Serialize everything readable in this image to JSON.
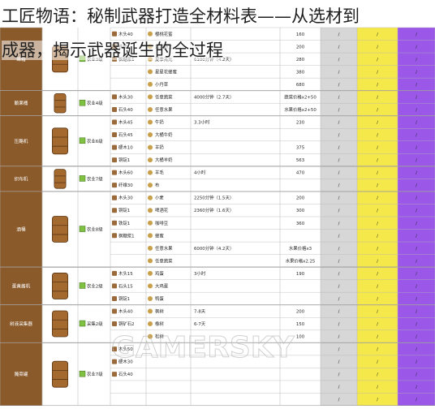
{
  "title": {
    "line1": "工匠物语：秘制武器打造全材料表——从选材到",
    "line2": "成器，揭示武器诞生的全过程"
  },
  "watermark": "GAMERSKY",
  "colors": {
    "brown": "#8a5a2b",
    "yellow": "#f5e84a",
    "purple": "#9a57e8",
    "grey": "#d7d7d7",
    "green": "#7fc241",
    "grid": "#b5b5b5"
  },
  "sections": [
    {
      "name": "蜂箱",
      "level": "农业3级",
      "rows": [
        {
          "mat": "木头40",
          "prod": "樱桃花蜜",
          "time": "",
          "sell": "160"
        },
        {
          "mat": "铁锭1",
          "prod": "蓝调爵士",
          "time": "",
          "sell": "200"
        },
        {
          "mat": "枫糖浆1",
          "prod": "夏季亮光",
          "time": "6100分钟（4.2天）",
          "sell": "280"
        },
        {
          "mat": "",
          "prod": "星星花蜂蜜",
          "time": "",
          "sell": "380"
        },
        {
          "mat": "",
          "prod": "小丹草",
          "time": "",
          "sell": "680"
        }
      ]
    },
    {
      "name": "酿果桶",
      "level": "农业4级",
      "rows": [
        {
          "mat": "木头30",
          "prod": "任意蔬菜",
          "time": "4000分钟（2.7天）",
          "sell": "蔬菜价格x2+50"
        },
        {
          "mat": "石头40",
          "prod": "任意水果",
          "time": "",
          "sell": "水果价格x2+50"
        }
      ]
    },
    {
      "name": "压酪机",
      "level": "农业6级",
      "rows": [
        {
          "mat": "木头45",
          "prod": "牛奶",
          "time": "3.3小时",
          "sell": "230"
        },
        {
          "mat": "石头45",
          "prod": "大桶牛奶",
          "time": "",
          "sell": ""
        },
        {
          "mat": "硬木10",
          "prod": "羊奶",
          "time": "",
          "sell": "375"
        },
        {
          "mat": "铜锭1",
          "prod": "大桶羊奶",
          "time": "",
          "sell": "563"
        }
      ]
    },
    {
      "name": "织布机",
      "level": "农业7级",
      "rows": [
        {
          "mat": "木头60",
          "prod": "羊毛",
          "time": "4小时",
          "sell": "470"
        },
        {
          "mat": "纤维30",
          "prod": "布",
          "time": "",
          "sell": ""
        }
      ]
    },
    {
      "name": "酒桶",
      "level": "农业8级",
      "rows": [
        {
          "mat": "木头30",
          "prod": "小麦",
          "time": "2250分钟（1.5天）",
          "sell": "200"
        },
        {
          "mat": "铜锭1",
          "prod": "啤酒花",
          "time": "2360分钟（1.6天）",
          "sell": "300"
        },
        {
          "mat": "铁锭1",
          "prod": "咖啡豆",
          "time": "",
          "sell": "360"
        },
        {
          "mat": "枫糖浆1",
          "prod": "蜂蜜",
          "time": "",
          "sell": ""
        },
        {
          "mat": "",
          "prod": "任意水果",
          "time": "6000分钟（4.2天）",
          "sell": "水果价格x3"
        },
        {
          "mat": "",
          "prod": "任意蔬菜",
          "time": "",
          "sell": "水果价格x2.25"
        }
      ]
    },
    {
      "name": "蛋黄酱机",
      "level": "农业2级",
      "rows": [
        {
          "mat": "木头15",
          "prod": "鸡蛋",
          "time": "3小时",
          "sell": "190"
        },
        {
          "mat": "石头15",
          "prod": "大鸡蛋",
          "time": "",
          "sell": ""
        },
        {
          "mat": "铜锭1",
          "prod": "鸭蛋",
          "time": "",
          "sell": ""
        }
      ]
    },
    {
      "name": "树液采集器",
      "level": "采集2级",
      "rows": [
        {
          "mat": "木头40",
          "prod": "枫树",
          "time": "7-8天",
          "sell": "200"
        },
        {
          "mat": "铜矿石2",
          "prod": "橡树",
          "time": "6-7天",
          "sell": "150"
        },
        {
          "mat": "",
          "prod": "松树",
          "time": "",
          "sell": "100"
        }
      ]
    },
    {
      "name": "腌菜罐",
      "level": "农业7级",
      "rows": [
        {
          "mat": "木头50",
          "prod": "",
          "time": "",
          "sell": ""
        },
        {
          "mat": "硬木30",
          "prod": "",
          "time": "",
          "sell": ""
        },
        {
          "mat": "石头40",
          "prod": "",
          "time": "",
          "sell": ""
        },
        {
          "mat": "",
          "prod": "",
          "time": "",
          "sell": ""
        },
        {
          "mat": "",
          "prod": "",
          "time": "",
          "sell": ""
        }
      ]
    }
  ]
}
